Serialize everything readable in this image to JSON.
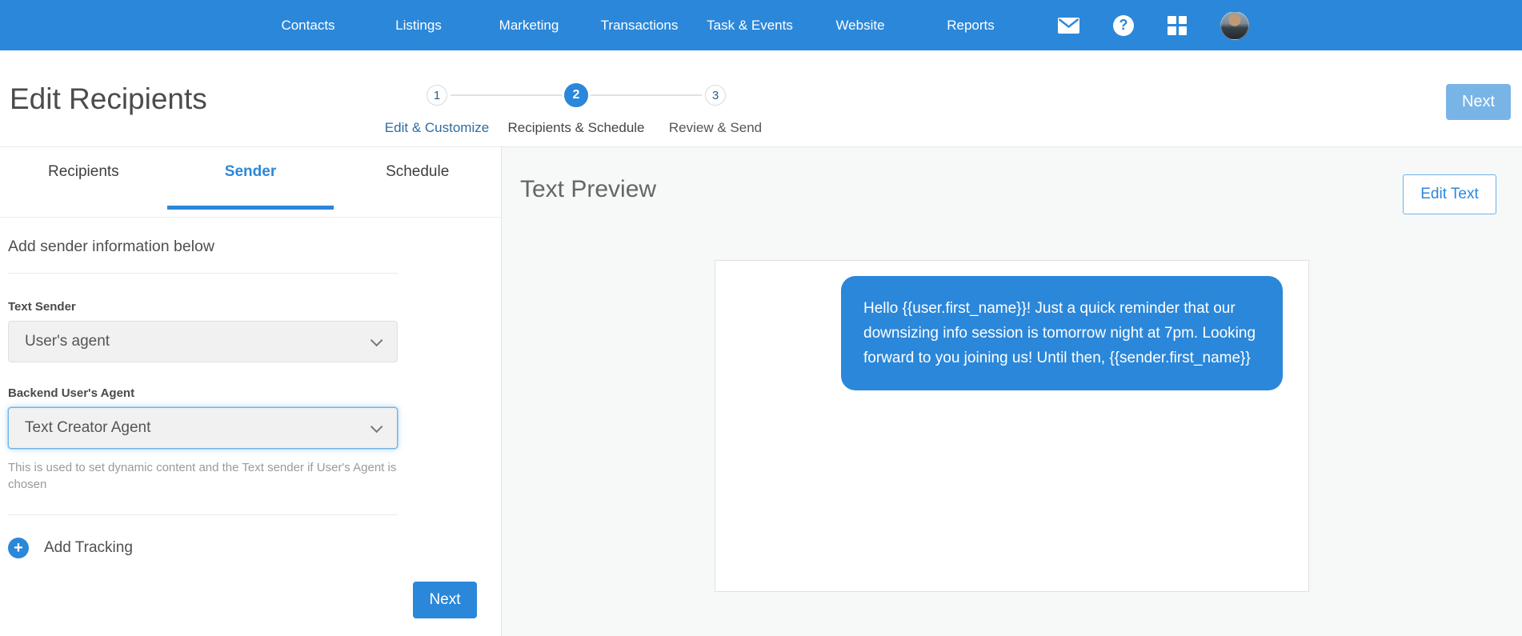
{
  "colors": {
    "brand_blue": "#2b87d9",
    "light_blue_button": "#79b4e7",
    "panel_background": "#f7f8f8"
  },
  "nav": {
    "items": [
      {
        "label": "Contacts"
      },
      {
        "label": "Listings"
      },
      {
        "label": "Marketing"
      },
      {
        "label": "Transactions"
      },
      {
        "label": "Task & Events"
      },
      {
        "label": "Website"
      },
      {
        "label": "Reports"
      }
    ],
    "icons": [
      {
        "name": "mail-icon"
      },
      {
        "name": "help-icon",
        "glyph": "?"
      },
      {
        "name": "apps-grid-icon"
      },
      {
        "name": "user-avatar"
      }
    ]
  },
  "header": {
    "title": "Edit Recipients",
    "next_button": "Next"
  },
  "stepper": {
    "steps": [
      {
        "number": "1",
        "label": "Edit & Customize",
        "state": "visited"
      },
      {
        "number": "2",
        "label": "Recipients & Schedule",
        "state": "active"
      },
      {
        "number": "3",
        "label": "Review & Send",
        "state": "upcoming"
      }
    ]
  },
  "sidebar": {
    "tabs": [
      {
        "label": "Recipients"
      },
      {
        "label": "Sender"
      },
      {
        "label": "Schedule"
      }
    ],
    "section_heading": "Add sender information below",
    "text_sender": {
      "label": "Text Sender",
      "value": "User's agent"
    },
    "backend_agent": {
      "label": "Backend User's Agent",
      "value": "Text Creator Agent"
    },
    "helper_text": "This is used to set dynamic content and the Text sender if User's Agent is chosen",
    "add_tracking_label": "Add Tracking",
    "next_button": "Next"
  },
  "preview": {
    "title": "Text Preview",
    "edit_button": "Edit Text",
    "message": "Hello {{user.first_name}}! Just a quick reminder that our downsizing info session is tomorrow night at 7pm. Looking forward to you joining us! Until then, {{sender.first_name}}"
  }
}
